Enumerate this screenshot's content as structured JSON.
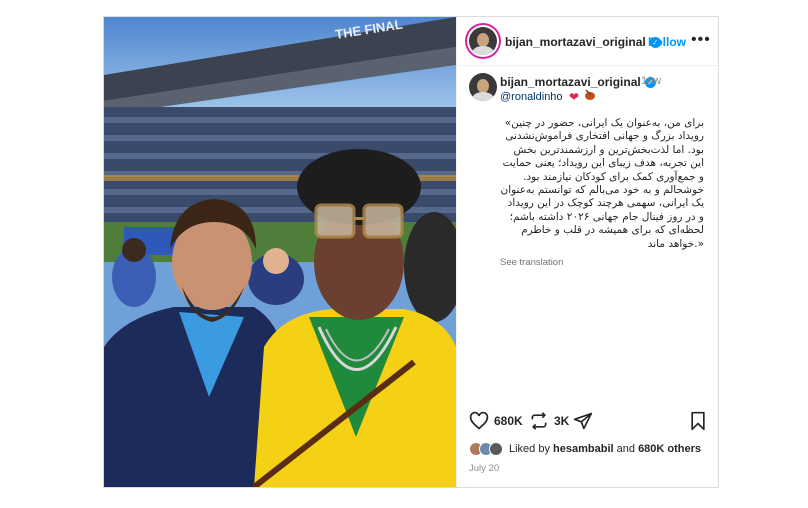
{
  "post": {
    "username": "bijan_mortazavi_original",
    "verified_mark": "✓",
    "follow_label": "Follow",
    "more_label": "•••",
    "time_ago": "10w",
    "mention": "@ronaldinho",
    "caption_lines": [
      "برای من، به‌عنوان یک ایرانی، حضور در چنین»",
      "رویداد بزرگ و جهانی افتخاری فراموش‌نشدنی",
      "بود. اما لذت‌بخش‌ترین و ارزشمندترین بخش",
      "این تجربه، هدف زیبای این رویداد؛ یعنی حمایت",
      "و جمع‌آوری کمک برای کودکان نیازمند بود.",
      "خوشحالم و به خود می‌بالم که توانستم به‌عنوان",
      "یک ایرانی، سهمی هرچند کوچک در این رویداد",
      "و در روز فینال جام جهانی ۲۰۲۶ داشته باشم؛",
      "لحظه‌ای که برای همیشه در قلب و خاطرم",
      "«.خواهد ماند"
    ],
    "see_translation": "See translation",
    "like_count": "680K",
    "repost_count": "3K",
    "liked_by_prefix": "Liked by",
    "liked_by_user": "hesambabil",
    "liked_by_and": "and",
    "liked_by_others": "680K others",
    "date": "July 20"
  },
  "photo": {
    "stadium_banner": "THE FINAL"
  },
  "icons": [
    "heart-icon",
    "repost-icon",
    "share-icon",
    "bookmark-icon",
    "more-icon",
    "verified-icon"
  ],
  "colors": {
    "accent": "#0095f6",
    "mention": "#00376b",
    "muted": "#8e8e8e",
    "jersey": "#f5d116",
    "jacket": "#1c2b5a"
  }
}
